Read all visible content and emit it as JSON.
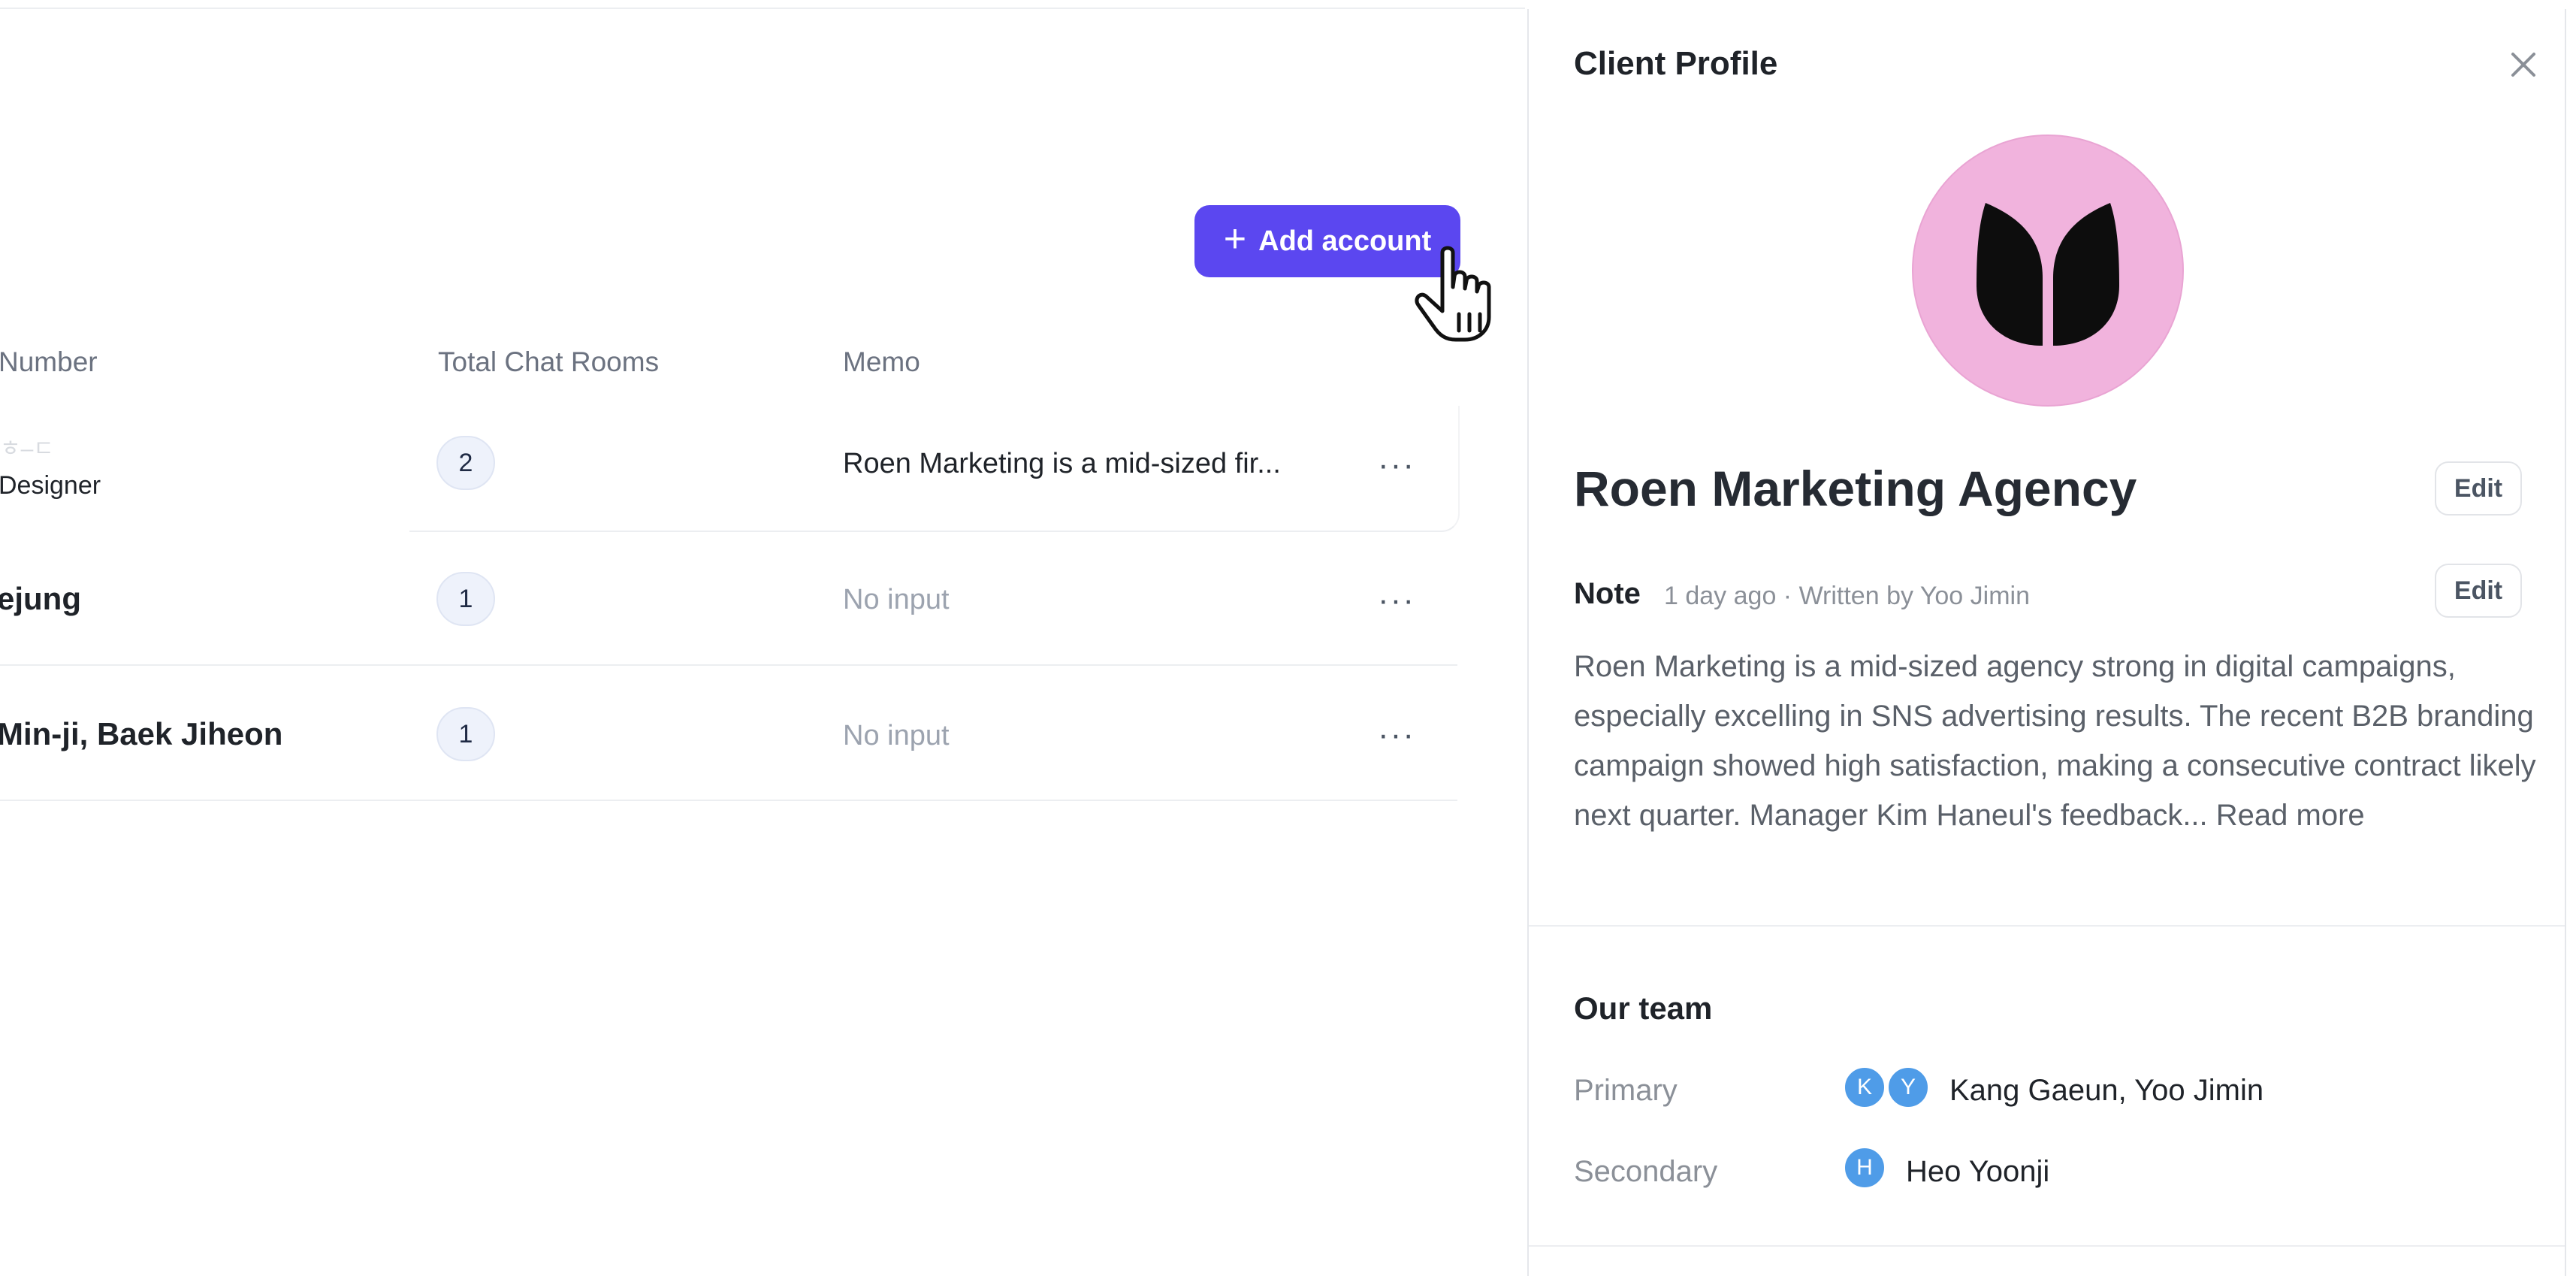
{
  "toolbar": {
    "add_account_label": "Add account"
  },
  "table": {
    "headers": {
      "number": "Number",
      "total_chat_rooms": "Total Chat Rooms",
      "memo": "Memo"
    },
    "rows": [
      {
        "name_fragment": "",
        "faded_text": "ㅎ–ㄷ",
        "role": "Designer",
        "chat_rooms": "2",
        "memo": "Roen Marketing is a mid-sized fir..."
      },
      {
        "name_fragment": "ejung",
        "chat_rooms": "1",
        "memo": "No input"
      },
      {
        "name_fragment": "Min-ji, Baek Jiheon",
        "chat_rooms": "1",
        "memo": "No input"
      }
    ],
    "more_label": "···"
  },
  "panel": {
    "title": "Client Profile",
    "company_name": "Roen Marketing Agency",
    "edit_label": "Edit",
    "note": {
      "label": "Note",
      "meta": "1 day ago · Written by Yoo Jimin",
      "text": "Roen Marketing is a mid-sized agency strong in digital campaigns, especially excelling in SNS advertising results. The recent B2B branding campaign showed high satisfaction, making a consecutive contract likely next quarter. Manager Kim Haneul's feedback...",
      "read_more": "Read more"
    },
    "team": {
      "title": "Our team",
      "primary_label": "Primary",
      "primary_avatars": [
        "K",
        "Y"
      ],
      "primary_names": "Kang Gaeun, Yoo Jimin",
      "secondary_label": "Secondary",
      "secondary_avatars": [
        "H"
      ],
      "secondary_names": "Heo Yoonji"
    }
  },
  "colors": {
    "accent": "#5b47f0",
    "avatar": "#4f9ce8",
    "logo_bg": "#f1b3dd"
  }
}
